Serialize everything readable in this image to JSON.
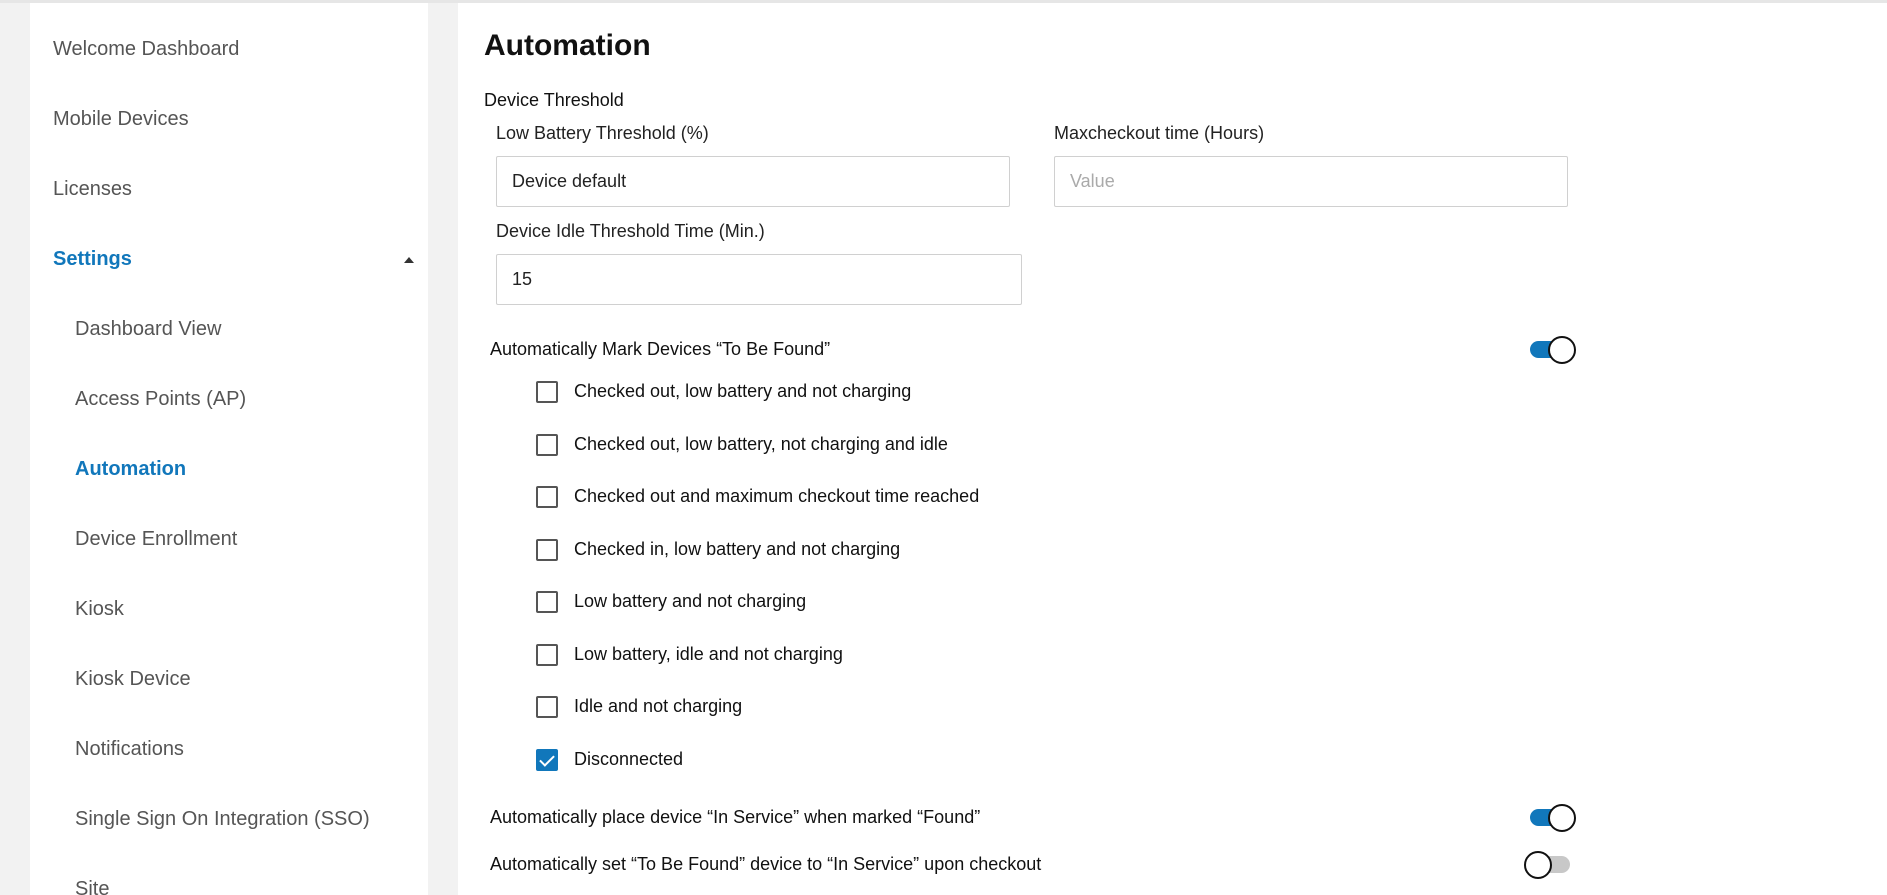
{
  "sidebar": {
    "items": [
      {
        "label": "Welcome Dashboard"
      },
      {
        "label": "Mobile Devices"
      },
      {
        "label": "Licenses"
      },
      {
        "label": "Settings"
      },
      {
        "label": "Dashboard View"
      },
      {
        "label": "Access Points (AP)"
      },
      {
        "label": "Automation"
      },
      {
        "label": "Device Enrollment"
      },
      {
        "label": "Kiosk"
      },
      {
        "label": "Kiosk Device"
      },
      {
        "label": "Notifications"
      },
      {
        "label": "Single Sign On Integration (SSO)"
      },
      {
        "label": "Site"
      }
    ],
    "caret_icon": "caret-up-icon",
    "active_color": "#1177bb"
  },
  "main": {
    "title": "Automation",
    "section": "Device Threshold",
    "low_battery": {
      "label": "Low Battery Threshold (%)",
      "value": "Device default"
    },
    "max_checkout": {
      "label": "Maxcheckout time (Hours)",
      "value": "",
      "placeholder": "Value"
    },
    "idle_threshold": {
      "label": "Device Idle Threshold Time (Min.)",
      "value": "15"
    },
    "auto_mark": {
      "label": "Automatically Mark Devices “To Be Found”",
      "enabled": true
    },
    "conditions": [
      {
        "label": "Checked out, low battery and not charging",
        "checked": false
      },
      {
        "label": "Checked out, low battery, not charging and idle",
        "checked": false
      },
      {
        "label": "Checked out and maximum checkout time reached",
        "checked": false
      },
      {
        "label": "Checked in, low battery and not charging",
        "checked": false
      },
      {
        "label": "Low battery and not charging",
        "checked": false
      },
      {
        "label": "Low battery, idle and not charging",
        "checked": false
      },
      {
        "label": "Idle and not charging",
        "checked": false
      },
      {
        "label": "Disconnected",
        "checked": true
      }
    ],
    "auto_in_service": {
      "label": "Automatically place device “In Service” when marked “Found”",
      "enabled": true
    },
    "auto_checkout": {
      "label": "Automatically set “To Be Found” device to “In Service” upon checkout",
      "enabled": false
    }
  }
}
